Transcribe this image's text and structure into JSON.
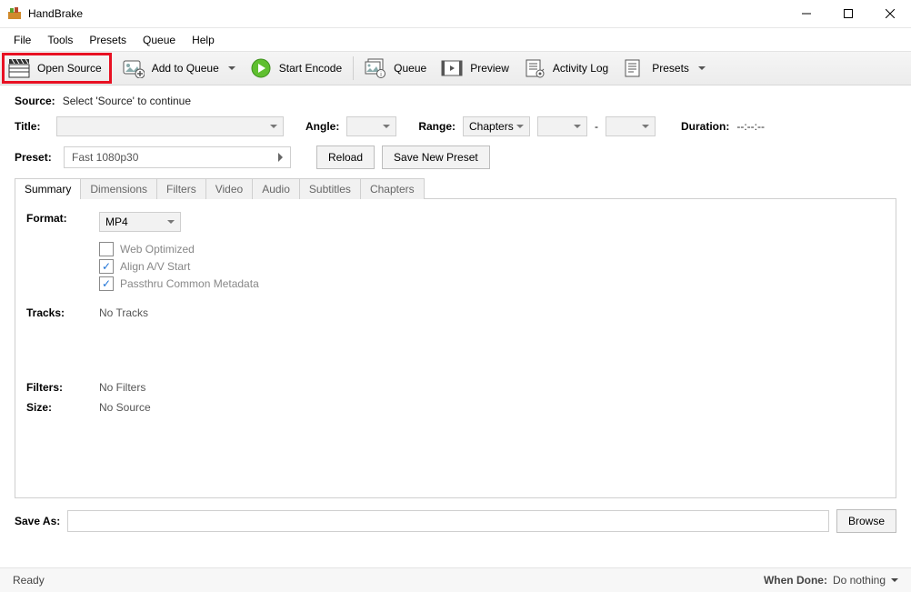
{
  "window": {
    "title": "HandBrake"
  },
  "menu": {
    "items": [
      "File",
      "Tools",
      "Presets",
      "Queue",
      "Help"
    ]
  },
  "toolbar": {
    "open_source": "Open Source",
    "add_to_queue": "Add to Queue",
    "start_encode": "Start Encode",
    "queue": "Queue",
    "preview": "Preview",
    "activity_log": "Activity Log",
    "presets": "Presets"
  },
  "source": {
    "label": "Source:",
    "hint": "Select 'Source' to continue"
  },
  "title_line": {
    "title_label": "Title:",
    "angle_label": "Angle:",
    "range_label": "Range:",
    "range_mode": "Chapters",
    "dash": "-",
    "duration_label": "Duration:",
    "duration_value": "--:--:--"
  },
  "preset_line": {
    "label": "Preset:",
    "value": "Fast 1080p30",
    "reload": "Reload",
    "save_new": "Save New Preset"
  },
  "tabs": [
    "Summary",
    "Dimensions",
    "Filters",
    "Video",
    "Audio",
    "Subtitles",
    "Chapters"
  ],
  "summary": {
    "format_label": "Format:",
    "format_value": "MP4",
    "web_optimized": "Web Optimized",
    "align_av": "Align A/V Start",
    "passthru": "Passthru Common Metadata",
    "tracks_label": "Tracks:",
    "tracks_value": "No Tracks",
    "filters_label": "Filters:",
    "filters_value": "No Filters",
    "size_label": "Size:",
    "size_value": "No Source"
  },
  "saveas": {
    "label": "Save As:",
    "browse": "Browse"
  },
  "status": {
    "ready": "Ready",
    "when_done_label": "When Done:",
    "when_done_value": "Do nothing"
  }
}
